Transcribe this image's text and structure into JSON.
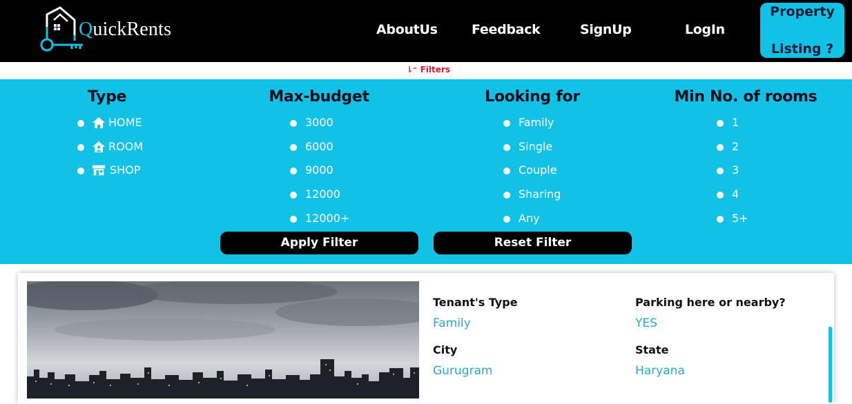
{
  "brand": {
    "name_q": "Q",
    "name_rest": "uickRents"
  },
  "nav": {
    "about": "AboutUs",
    "feedback": "Feedback",
    "signup": "SignUp",
    "login": "LogIn",
    "listing_line1": "Property",
    "listing_line2": "Listing ?"
  },
  "filters_toggle": "⇂⁼ Filters",
  "filter_panel": {
    "type": {
      "title": "Type",
      "options": [
        {
          "label": "HOME",
          "icon": "house-icon"
        },
        {
          "label": "ROOM",
          "icon": "home-user-icon"
        },
        {
          "label": "SHOP",
          "icon": "store-icon"
        }
      ]
    },
    "budget": {
      "title": "Max-budget",
      "options": [
        "3000",
        "6000",
        "9000",
        "12000",
        "12000+"
      ]
    },
    "looking": {
      "title": "Looking for",
      "options": [
        "Family",
        "Single",
        "Couple",
        "Sharing",
        "Any"
      ]
    },
    "rooms": {
      "title": "Min No. of rooms",
      "options": [
        "1",
        "2",
        "3",
        "4",
        "5+"
      ]
    },
    "apply_label": "Apply Filter",
    "reset_label": "Reset Filter"
  },
  "listing": {
    "tenant_label": "Tenant's Type",
    "tenant_value": "Family",
    "parking_label": "Parking here or nearby?",
    "parking_value": "YES",
    "city_label": "City",
    "city_value": "Gurugram",
    "state_label": "State",
    "state_value": "Haryana"
  },
  "colors": {
    "accent": "#12c2e6",
    "nav_bg": "#000000",
    "filter_red": "#e3162b",
    "value_blue": "#2aa8cf"
  }
}
